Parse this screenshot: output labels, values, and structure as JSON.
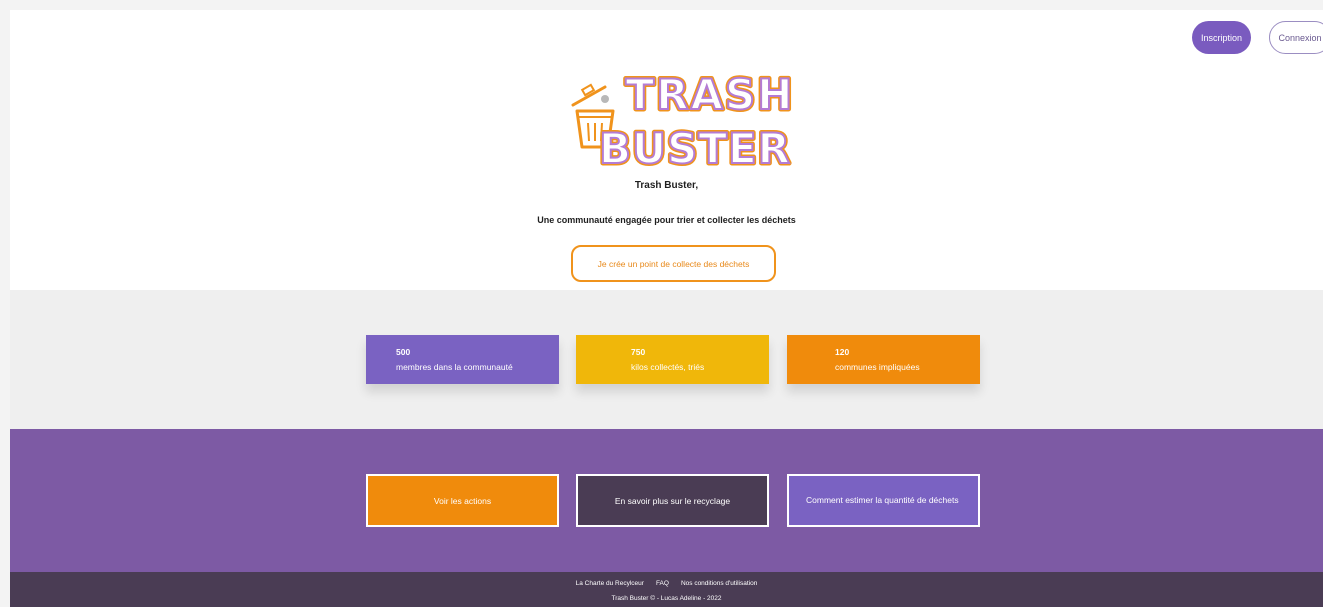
{
  "header": {
    "inscription_label": "Inscription",
    "connexion_label": "Connexion"
  },
  "logo": {
    "line1": "TRASH",
    "line2": "BUSTER",
    "colors": {
      "fill": "#b47cd4",
      "outline": "#f0931c"
    }
  },
  "hero": {
    "title": "Trash Buster,",
    "tagline": "Une communauté engagée pour trier et collecter les déchets",
    "cta_label": "Je crée un point de collecte des déchets"
  },
  "stats": [
    {
      "value": "500",
      "label": "membres dans la communauté",
      "color": "#7a62c2"
    },
    {
      "value": "750",
      "label": "kilos collectés, triés",
      "color": "#f0b70a"
    },
    {
      "value": "120",
      "label": "communes impliquées",
      "color": "#f08b0c"
    }
  ],
  "actions": [
    {
      "label": "Voir les actions",
      "color": "#f08b0c"
    },
    {
      "label": "En savoir plus sur le recyclage",
      "color": "#4a3c54"
    },
    {
      "label": "Comment estimer la quantité de déchets",
      "color": "#7a62c2"
    }
  ],
  "footer": {
    "links": [
      "La Charte du Recylceur",
      "FAQ",
      "Nos conditions d'utilisation"
    ],
    "copyright": "Trash Buster © - Lucas Adeline - 2022"
  },
  "colors": {
    "purple_accent": "#7a5bbf",
    "actions_background": "#7d5aa4",
    "footer_background": "#4a3c54",
    "stats_background": "#efefef"
  }
}
